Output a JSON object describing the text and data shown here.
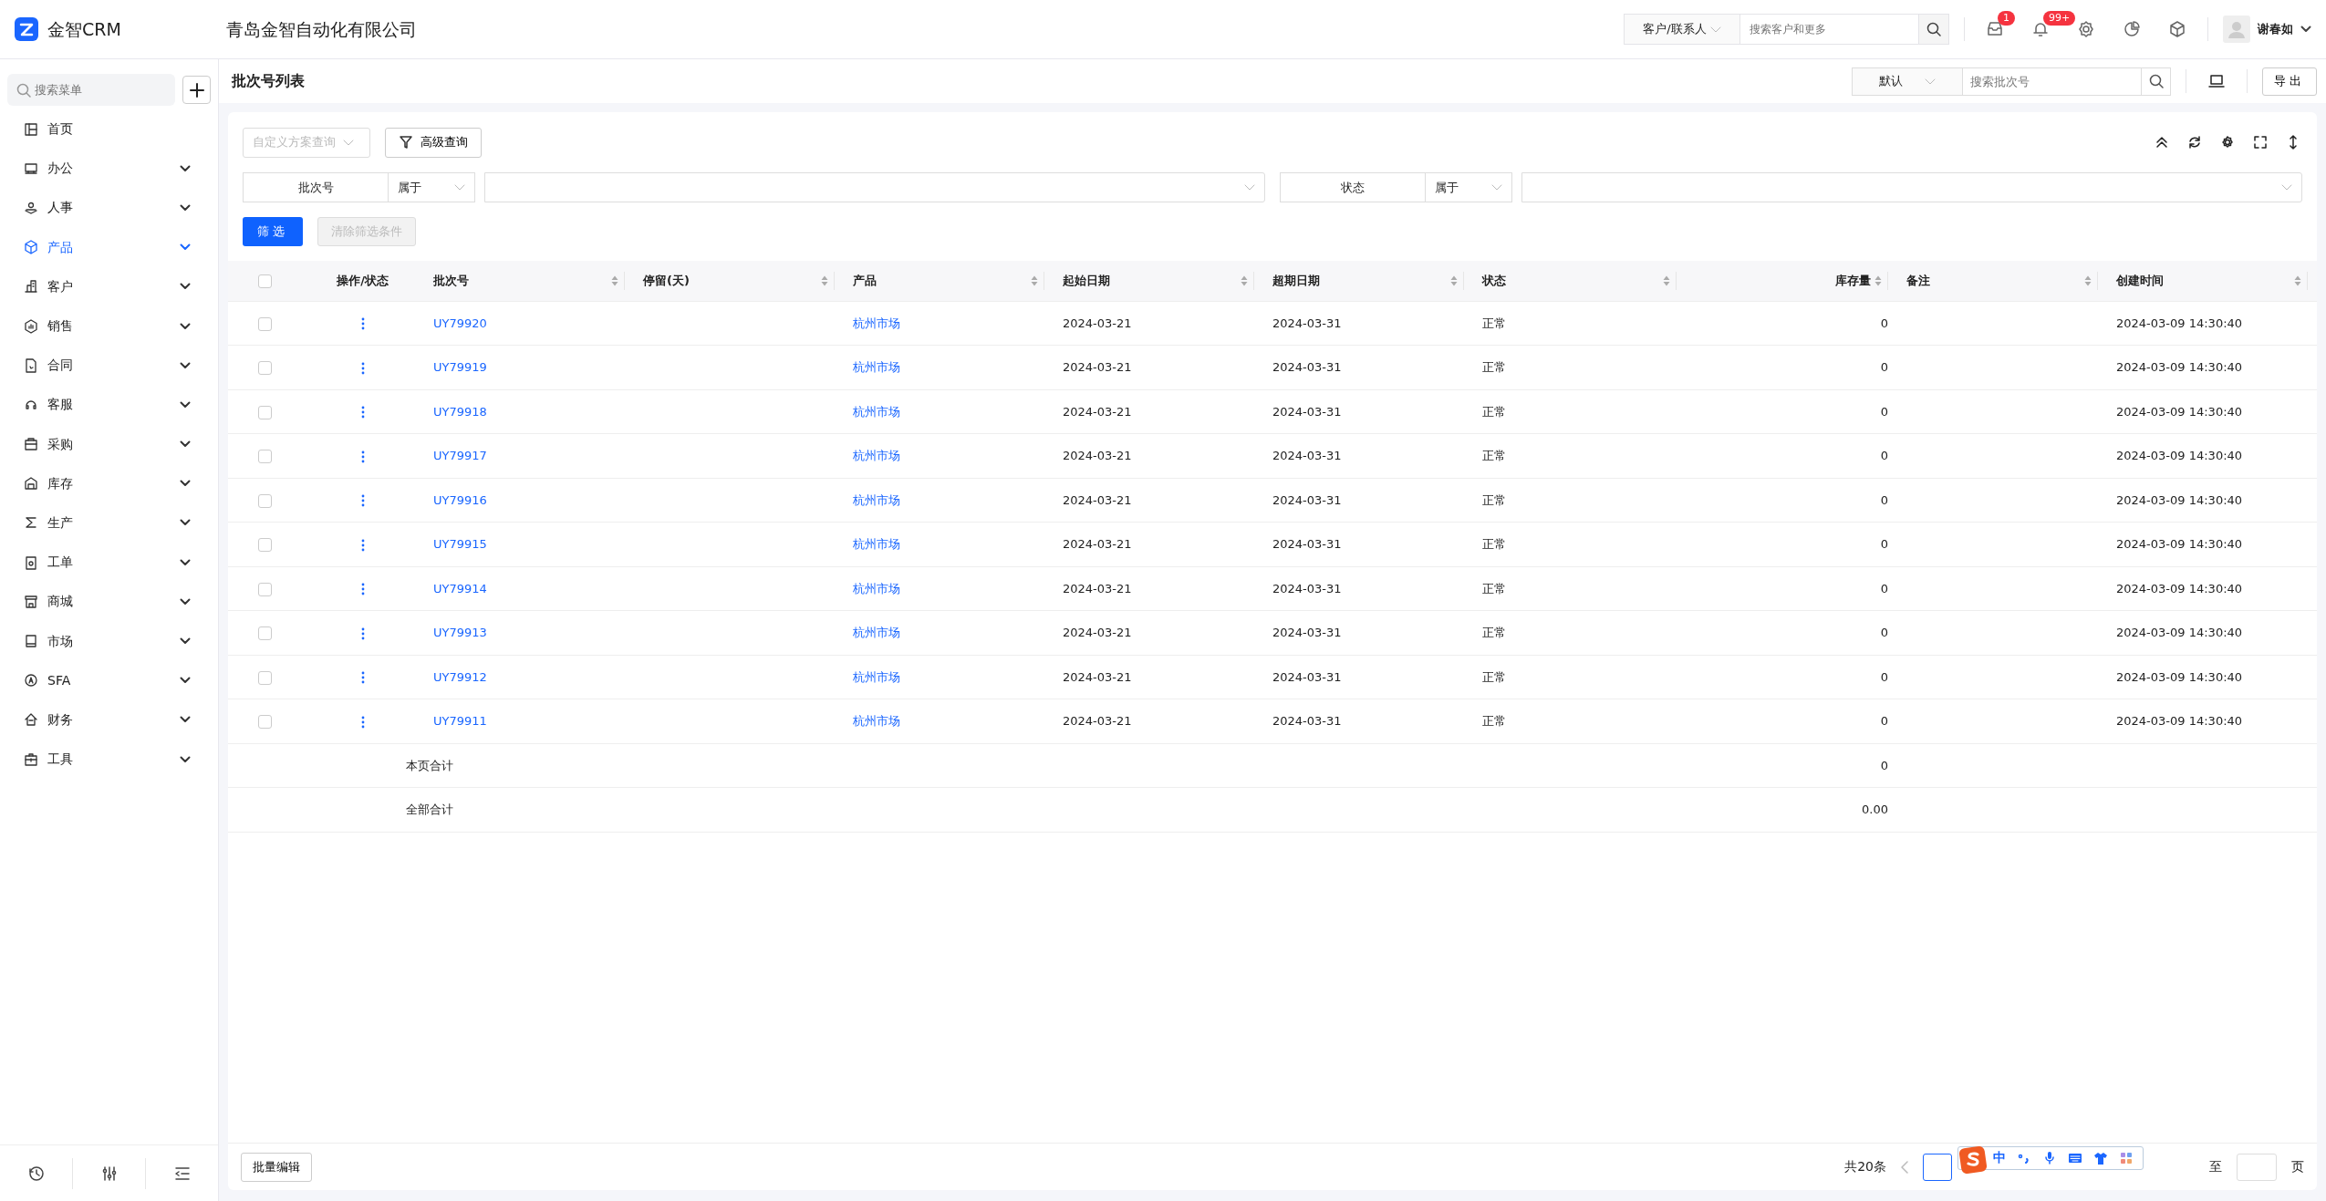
{
  "app": {
    "logo_text": "金智CRM",
    "company": "青岛金智自动化有限公司"
  },
  "header": {
    "search_scope": "客户/联系人",
    "search_placeholder": "搜索客户和更多",
    "badges": [
      "1",
      "99+"
    ],
    "user": "谢春如"
  },
  "sidebar": {
    "search_placeholder": "搜索菜单",
    "items": [
      {
        "label": "首页",
        "selected": false,
        "expandable": false
      },
      {
        "label": "办公",
        "selected": false,
        "expandable": true
      },
      {
        "label": "人事",
        "selected": false,
        "expandable": true
      },
      {
        "label": "产品",
        "selected": true,
        "expandable": true
      },
      {
        "label": "客户",
        "selected": false,
        "expandable": true
      },
      {
        "label": "销售",
        "selected": false,
        "expandable": true
      },
      {
        "label": "合同",
        "selected": false,
        "expandable": true
      },
      {
        "label": "客服",
        "selected": false,
        "expandable": true
      },
      {
        "label": "采购",
        "selected": false,
        "expandable": true
      },
      {
        "label": "库存",
        "selected": false,
        "expandable": true
      },
      {
        "label": "生产",
        "selected": false,
        "expandable": true
      },
      {
        "label": "工单",
        "selected": false,
        "expandable": true
      },
      {
        "label": "商城",
        "selected": false,
        "expandable": true
      },
      {
        "label": "市场",
        "selected": false,
        "expandable": true
      },
      {
        "label": "SFA",
        "selected": false,
        "expandable": true
      },
      {
        "label": "财务",
        "selected": false,
        "expandable": true
      },
      {
        "label": "工具",
        "selected": false,
        "expandable": true
      }
    ]
  },
  "page": {
    "title": "批次号列表",
    "view_select": "默认",
    "search_placeholder": "搜索批次号",
    "export": "导出"
  },
  "filters": {
    "scheme_placeholder": "自定义方案查询",
    "advanced": "高级查询",
    "conditions": [
      {
        "field": "批次号",
        "operator": "属于"
      },
      {
        "field": "状态",
        "operator": "属于"
      }
    ],
    "apply": "筛选",
    "clear": {
      "label": "清除筛选条件",
      "disabled": true
    }
  },
  "table": {
    "header_checked": false,
    "columns": [
      {
        "label": "操作/状态",
        "sortable": false
      },
      {
        "label": "批次号",
        "sortable": true,
        "numeric": false
      },
      {
        "label": "停留(天)",
        "sortable": true,
        "numeric": false
      },
      {
        "label": "产品",
        "sortable": true,
        "numeric": false
      },
      {
        "label": "起始日期",
        "sortable": true,
        "numeric": false
      },
      {
        "label": "超期日期",
        "sortable": true,
        "numeric": false
      },
      {
        "label": "状态",
        "sortable": true,
        "numeric": false
      },
      {
        "label": "库存量",
        "sortable": true,
        "numeric": true
      },
      {
        "label": "备注",
        "sortable": true,
        "numeric": false
      },
      {
        "label": "创建时间",
        "sortable": true,
        "numeric": false
      }
    ],
    "rows": [
      {
        "checked": false,
        "batch": "UY79920",
        "product": "杭州市场",
        "start": "2024-03-21",
        "due": "2024-03-31",
        "status": "正常",
        "stock": "0",
        "created": "2024-03-09 14:30:40"
      },
      {
        "checked": false,
        "batch": "UY79919",
        "product": "杭州市场",
        "start": "2024-03-21",
        "due": "2024-03-31",
        "status": "正常",
        "stock": "0",
        "created": "2024-03-09 14:30:40"
      },
      {
        "checked": false,
        "batch": "UY79918",
        "product": "杭州市场",
        "start": "2024-03-21",
        "due": "2024-03-31",
        "status": "正常",
        "stock": "0",
        "created": "2024-03-09 14:30:40"
      },
      {
        "checked": false,
        "batch": "UY79917",
        "product": "杭州市场",
        "start": "2024-03-21",
        "due": "2024-03-31",
        "status": "正常",
        "stock": "0",
        "created": "2024-03-09 14:30:40"
      },
      {
        "checked": false,
        "batch": "UY79916",
        "product": "杭州市场",
        "start": "2024-03-21",
        "due": "2024-03-31",
        "status": "正常",
        "stock": "0",
        "created": "2024-03-09 14:30:40"
      },
      {
        "checked": false,
        "batch": "UY79915",
        "product": "杭州市场",
        "start": "2024-03-21",
        "due": "2024-03-31",
        "status": "正常",
        "stock": "0",
        "created": "2024-03-09 14:30:40"
      },
      {
        "checked": false,
        "batch": "UY79914",
        "product": "杭州市场",
        "start": "2024-03-21",
        "due": "2024-03-31",
        "status": "正常",
        "stock": "0",
        "created": "2024-03-09 14:30:40"
      },
      {
        "checked": false,
        "batch": "UY79913",
        "product": "杭州市场",
        "start": "2024-03-21",
        "due": "2024-03-31",
        "status": "正常",
        "stock": "0",
        "created": "2024-03-09 14:30:40"
      },
      {
        "checked": false,
        "batch": "UY79912",
        "product": "杭州市场",
        "start": "2024-03-21",
        "due": "2024-03-31",
        "status": "正常",
        "stock": "0",
        "created": "2024-03-09 14:30:40"
      },
      {
        "checked": false,
        "batch": "UY79911",
        "product": "杭州市场",
        "start": "2024-03-21",
        "due": "2024-03-31",
        "status": "正常",
        "stock": "0",
        "created": "2024-03-09 14:30:40"
      }
    ],
    "summaries": [
      {
        "label": "本页合计",
        "stock": "0"
      },
      {
        "label": "全部合计",
        "stock": "0.00"
      }
    ]
  },
  "footer": {
    "batch_edit": "批量编辑",
    "total": "共20条",
    "jump": "至",
    "page_unit": "页"
  },
  "ime": {
    "mode": "中"
  }
}
